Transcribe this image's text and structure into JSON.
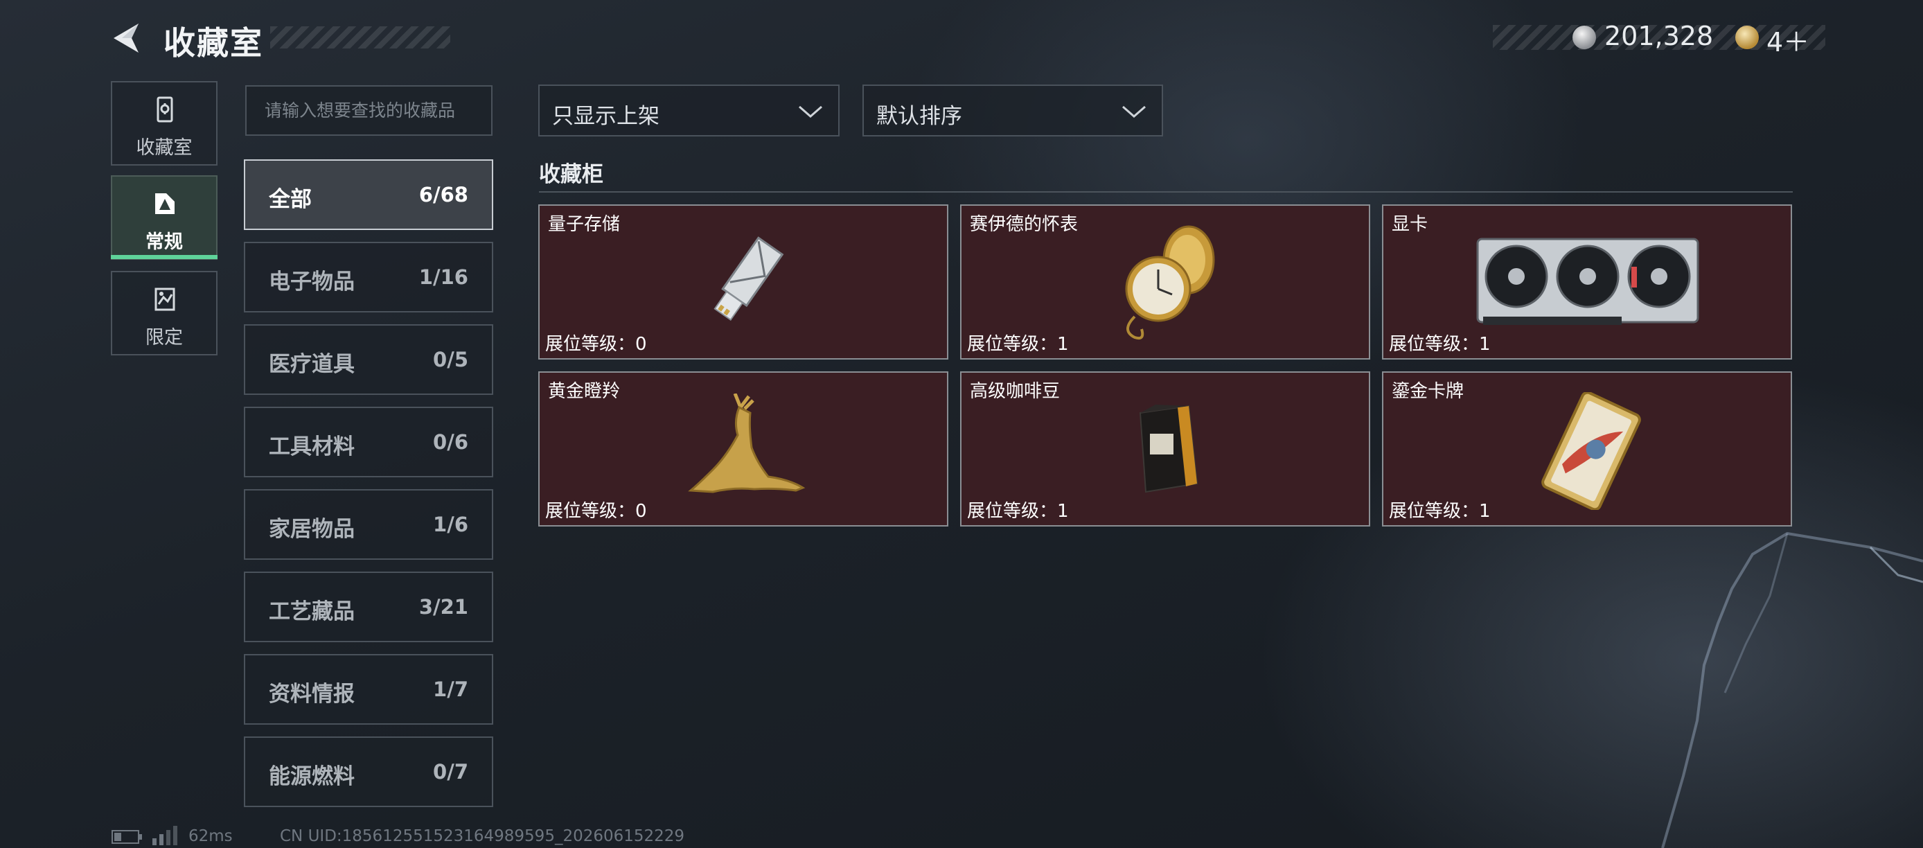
{
  "header": {
    "title": "收藏室",
    "currency1": "201,328",
    "currency2": "4＋"
  },
  "nav": [
    {
      "label": "收藏室",
      "icon": "collection-room-icon"
    },
    {
      "label": "常规",
      "icon": "regular-icon"
    },
    {
      "label": "限定",
      "icon": "limited-icon"
    }
  ],
  "search": {
    "placeholder": "请输入想要查找的收藏品",
    "value": ""
  },
  "categories": [
    {
      "name": "全部",
      "count": "6/68"
    },
    {
      "name": "电子物品",
      "count": "1/16"
    },
    {
      "name": "医疗道具",
      "count": "0/5"
    },
    {
      "name": "工具材料",
      "count": "0/6"
    },
    {
      "name": "家居物品",
      "count": "1/6"
    },
    {
      "name": "工艺藏品",
      "count": "3/21"
    },
    {
      "name": "资料情报",
      "count": "1/7"
    },
    {
      "name": "能源燃料",
      "count": "0/7"
    }
  ],
  "filter": {
    "selected": "只显示上架"
  },
  "sort": {
    "selected": "默认排序"
  },
  "section_title": "收藏柜",
  "items": [
    {
      "name": "量子存储",
      "level": "展位等级：0"
    },
    {
      "name": "赛伊德的怀表",
      "level": "展位等级：1"
    },
    {
      "name": "显卡",
      "level": "展位等级：1"
    },
    {
      "name": "黄金瞪羚",
      "level": "展位等级：0"
    },
    {
      "name": "高级咖啡豆",
      "level": "展位等级：1"
    },
    {
      "name": "鎏金卡牌",
      "level": "展位等级：1"
    }
  ],
  "footer": {
    "ping": "62ms",
    "uid": "CN UID:185612551523164989595_202606152229"
  },
  "colors": {
    "accent": "#5fd39a",
    "card_bg": "#3a1e23"
  }
}
